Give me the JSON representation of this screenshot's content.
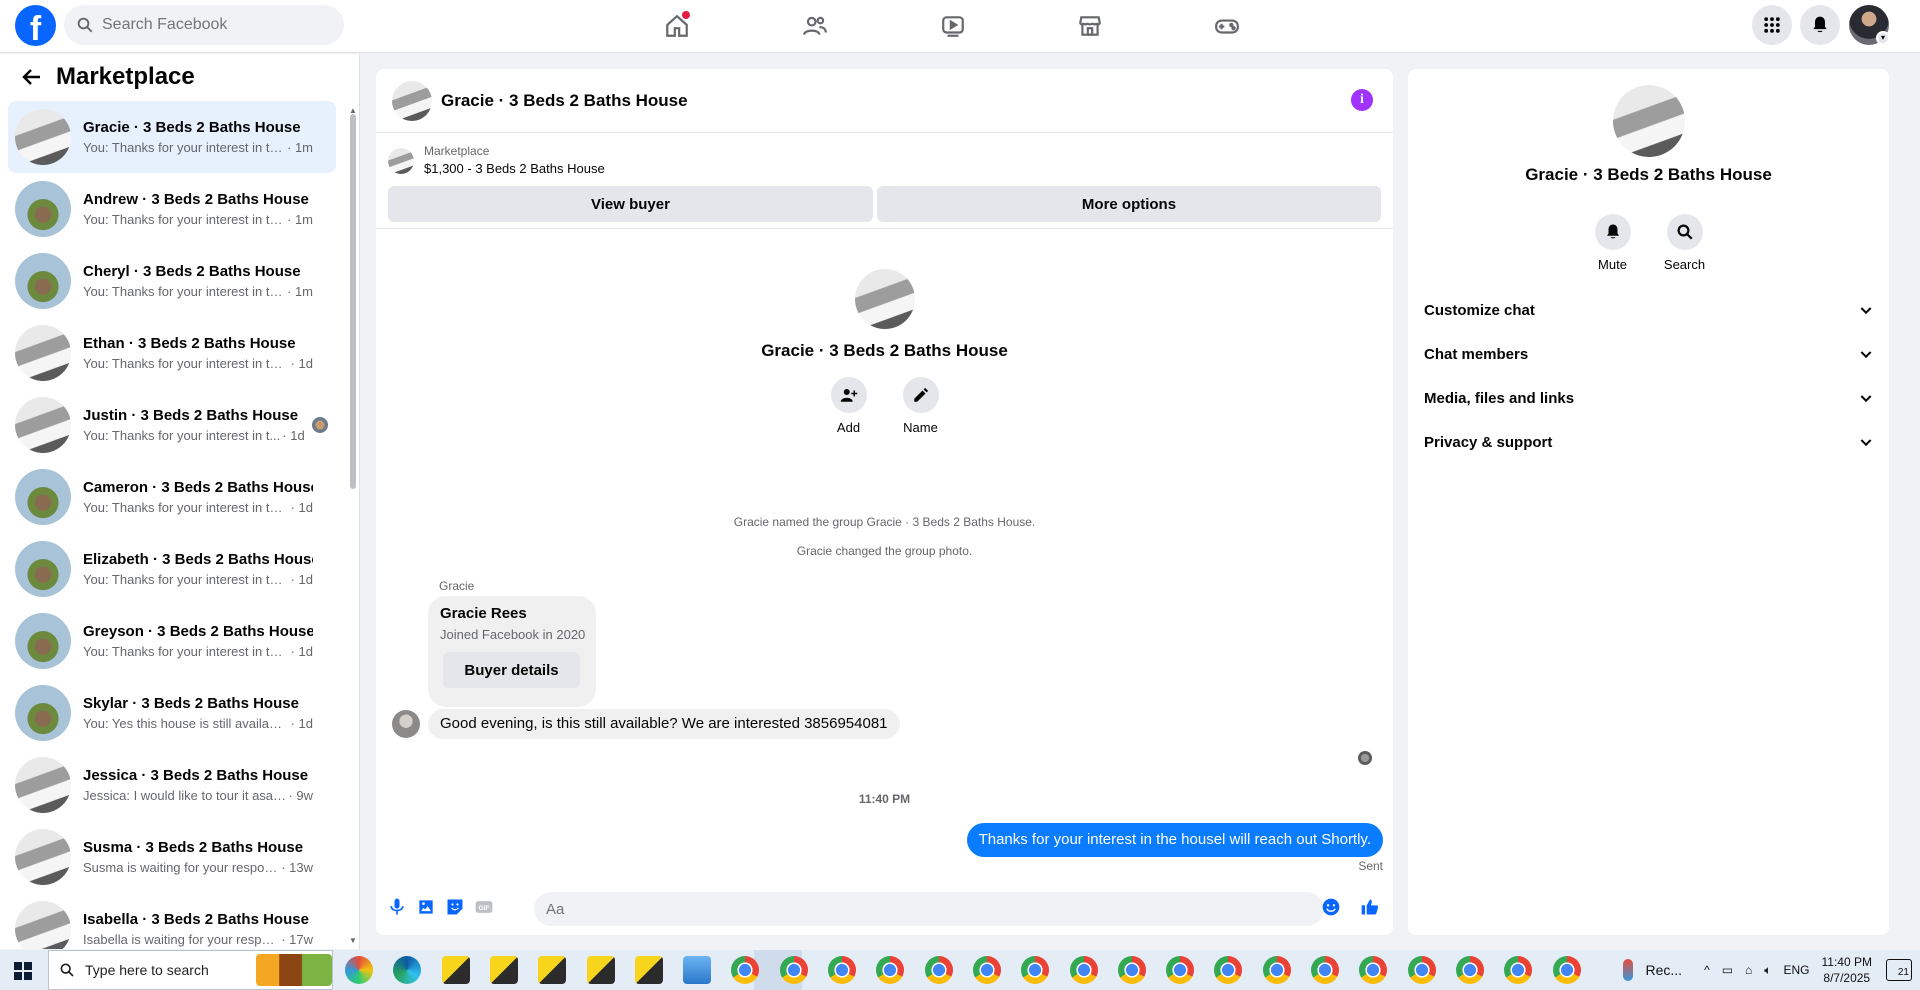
{
  "topbar": {
    "logo": "f",
    "search_placeholder": "Search Facebook",
    "nav": [
      "home-icon",
      "friends-icon",
      "watch-icon",
      "marketplace-icon",
      "gaming-icon"
    ],
    "right": [
      "menu-grid-icon",
      "notifications-icon",
      "profile-avatar"
    ]
  },
  "left": {
    "title": "Marketplace",
    "conversations": [
      {
        "name": "Gracie · 3 Beds 2 Baths House",
        "preview": "You: Thanks for your interest in the...",
        "time": "· 1m",
        "avatar": "kitchen",
        "active": true
      },
      {
        "name": "Andrew · 3 Beds 2 Baths House",
        "preview": "You: Thanks for your interest in the...",
        "time": "· 1m",
        "avatar": "house"
      },
      {
        "name": "Cheryl · 3 Beds 2 Baths House",
        "preview": "You: Thanks for your interest in the...",
        "time": "· 1m",
        "avatar": "house"
      },
      {
        "name": "Ethan · 3 Beds 2 Baths House",
        "preview": "You: Thanks for your interest in the ...",
        "time": "· 1d",
        "avatar": "kitchen"
      },
      {
        "name": "Justin · 3 Beds 2 Baths House",
        "preview": "You: Thanks for your interest in t...",
        "time": "· 1d",
        "avatar": "kitchen",
        "seen": true
      },
      {
        "name": "Cameron · 3 Beds 2 Baths House",
        "preview": "You: Thanks for your interest in the ...",
        "time": "· 1d",
        "avatar": "house"
      },
      {
        "name": "Elizabeth · 3 Beds 2 Baths House",
        "preview": "You: Thanks for your interest in the ...",
        "time": "· 1d",
        "avatar": "house"
      },
      {
        "name": "Greyson · 3 Beds 2 Baths House",
        "preview": "You: Thanks for your interest in the ...",
        "time": "· 1d",
        "avatar": "house"
      },
      {
        "name": "Skylar · 3 Beds 2 Baths House",
        "preview": "You: Yes this house is still available ...",
        "time": "· 1d",
        "avatar": "house"
      },
      {
        "name": "Jessica · 3 Beds 2 Baths House",
        "preview": "Jessica: I would like to tour it asap, ...",
        "time": "· 9w",
        "avatar": "kitchen"
      },
      {
        "name": "Susma · 3 Beds 2 Baths House",
        "preview": "Susma is waiting for your response.",
        "time": "· 13w",
        "avatar": "kitchen"
      },
      {
        "name": "Isabella · 3 Beds 2 Baths House",
        "preview": "Isabella is waiting for your respon...",
        "time": "· 17w",
        "avatar": "kitchen"
      }
    ]
  },
  "chat": {
    "title": "Gracie · 3 Beds 2 Baths House",
    "listing_label": "Marketplace",
    "listing_price": "$1,300 - 3 Beds 2 Baths House",
    "view_buyer": "View buyer",
    "more_options": "More options",
    "intro_name": "Gracie · 3 Beds 2 Baths House",
    "add_label": "Add",
    "name_label": "Name",
    "system_1": "Gracie named the group Gracie · 3 Beds 2 Baths House.",
    "system_2": "Gracie changed the group photo.",
    "sender": "Gracie",
    "card_name": "Gracie Rees",
    "card_joined": "Joined Facebook in 2020",
    "buyer_details": "Buyer details",
    "incoming": "Good evening, is this still available? We are interested 3856954081",
    "time": "11:40 PM",
    "outgoing": "Thanks for your interest in the housel will reach out Shortly.",
    "sent": "Sent",
    "composer_placeholder": "Aa"
  },
  "right": {
    "name": "Gracie · 3 Beds 2 Baths House",
    "mute": "Mute",
    "search": "Search",
    "sections": [
      "Customize chat",
      "Chat members",
      "Media, files and links",
      "Privacy & support"
    ]
  },
  "taskbar": {
    "search_placeholder": "Type here to search",
    "recorder_label": "Rec...",
    "lang": "ENG",
    "time": "11:40 PM",
    "date": "8/7/2025",
    "notif_count": "21"
  },
  "colors": {
    "brand": "#0866ff",
    "outgoing_bubble": "#0a7cff",
    "info": "#a033ff",
    "active_row": "#e7f0fd"
  }
}
